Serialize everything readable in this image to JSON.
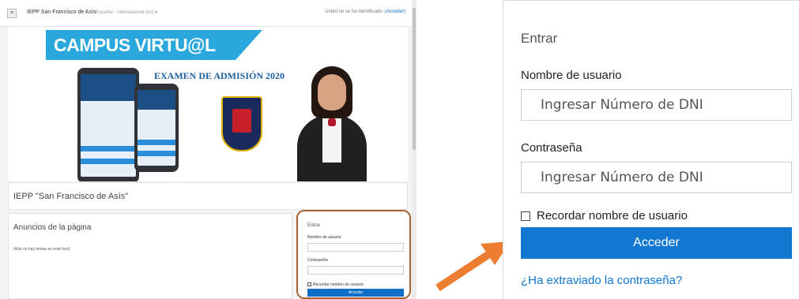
{
  "small_page": {
    "site_name": "IEPP San Francisco de Asís",
    "language": "Español - Internacional (es) ▾",
    "login_status_prefix": "Usted no se ha identificado.",
    "login_status_link": "(Acceder)",
    "menu_icon": "hamburger-icon",
    "banner": {
      "title": "CAMPUS VIRTU@L",
      "exam": "EXAMEN DE ADMISIÓN 2020"
    },
    "course_title": "IEPP \"San Francisco de Asís\"",
    "news_title": "Anuncios de la página",
    "news_empty": "(Aún no hay temas en este foro)",
    "login": {
      "title": "Entrar",
      "username_label": "Nombre de usuario",
      "password_label": "Contraseña",
      "remember_label": "Recordar nombre de usuario",
      "button": "Acceder"
    }
  },
  "zoom_login": {
    "title": "Entrar",
    "username_label": "Nombre de usuario",
    "username_placeholder": "Ingresar Número de DNI",
    "password_label": "Contraseña",
    "password_placeholder": "Ingresar Número de DNI",
    "remember_label": "Recordar nombre de usuario",
    "submit_label": "Acceder",
    "forgot_link": "¿Ha extraviado la contraseña?"
  },
  "colors": {
    "primary_blue": "#1177d1",
    "highlight_border": "#a86231",
    "arrow_orange": "#ed7d31",
    "banner_blue": "#2aa8dd"
  }
}
